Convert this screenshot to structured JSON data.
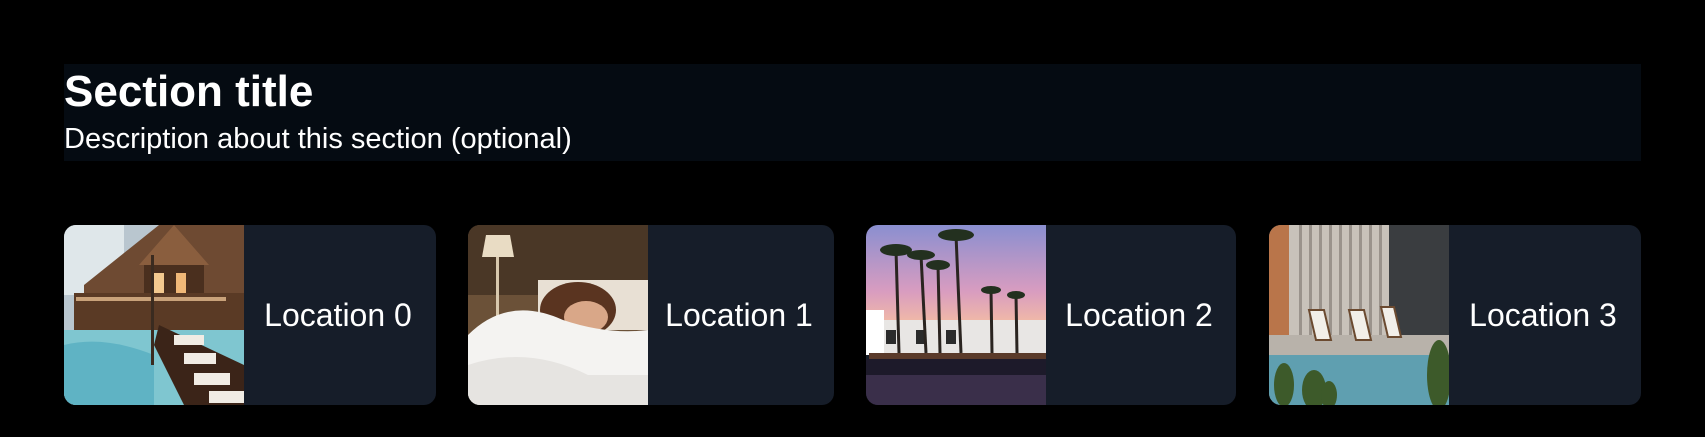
{
  "section": {
    "title": "Section title",
    "description": "Description about this section (optional)"
  },
  "locations": [
    {
      "label": "Location 0",
      "image": "resort-pool-lodge-photo"
    },
    {
      "label": "Location 1",
      "image": "person-sleeping-in-bed-photo"
    },
    {
      "label": "Location 2",
      "image": "palm-trees-pool-sunset-photo"
    },
    {
      "label": "Location 3",
      "image": "poolside-lounge-chairs-photo"
    }
  ],
  "colors": {
    "background": "#000000",
    "header_background": "#050b12",
    "card_background": "#161d29",
    "text": "#ffffff"
  }
}
